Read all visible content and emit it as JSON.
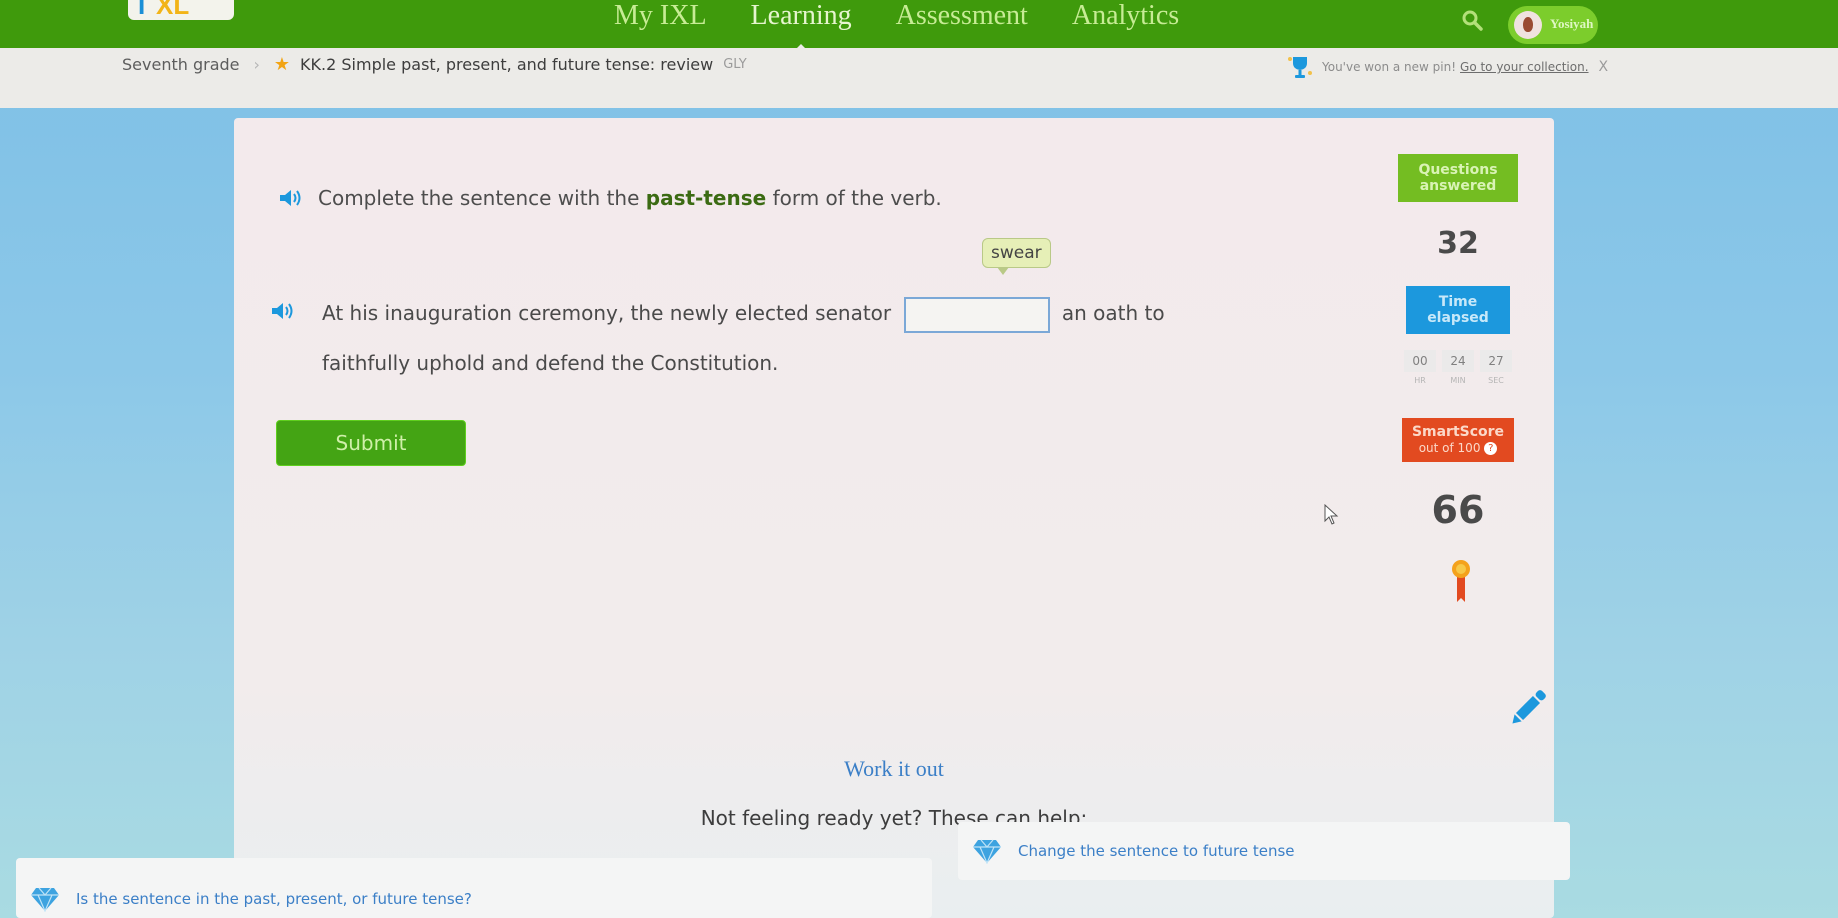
{
  "nav": {
    "logo": [
      "I",
      "XL"
    ],
    "links": [
      {
        "label": "My IXL",
        "active": false
      },
      {
        "label": "Learning",
        "active": true
      },
      {
        "label": "Assessment",
        "active": false
      },
      {
        "label": "Analytics",
        "active": false
      }
    ],
    "search_icon": "search-icon",
    "user_name": "Yosiyah"
  },
  "breadcrumb": {
    "grade": "Seventh grade",
    "separator": "›",
    "star": "★",
    "skill": "KK.2 Simple past, present, and future tense: review",
    "code": "GLY"
  },
  "notice": {
    "text": "You've won a new pin!",
    "link": "Go to your collection.",
    "close": "X"
  },
  "question": {
    "instruction_pre": "Complete the sentence with the",
    "instruction_bold": "past-tense",
    "instruction_post": "form of the verb.",
    "verb_hint": "swear",
    "sentence_pre": "At his inauguration ceremony, the newly elected senator",
    "sentence_post": "an oath to",
    "sentence_line2": "faithfully uphold and defend the Constitution.",
    "answer_value": "",
    "submit_label": "Submit"
  },
  "stats": {
    "questions_label": "Questions answered",
    "questions_value": "32",
    "time_label": "Time elapsed",
    "timer": [
      {
        "value": "00",
        "unit": "HR"
      },
      {
        "value": "24",
        "unit": "MIN"
      },
      {
        "value": "27",
        "unit": "SEC"
      }
    ],
    "smartscore_label": "SmartScore",
    "smartscore_sub": "out of 100",
    "help": "?",
    "smartscore_value": "66"
  },
  "help": {
    "work_it_out": "Work it out",
    "not_ready": "Not feeling ready yet? These can help:",
    "cards": [
      {
        "label": "Is the sentence in the past, present, or future tense?"
      },
      {
        "label": "Change the sentence to future tense"
      }
    ]
  },
  "colors": {
    "nav_green": "#3f9a0c",
    "questions_green": "#74bd22",
    "time_blue": "#1c98dd",
    "smartscore_red": "#e24a20",
    "link_blue": "#3b7fc7"
  }
}
